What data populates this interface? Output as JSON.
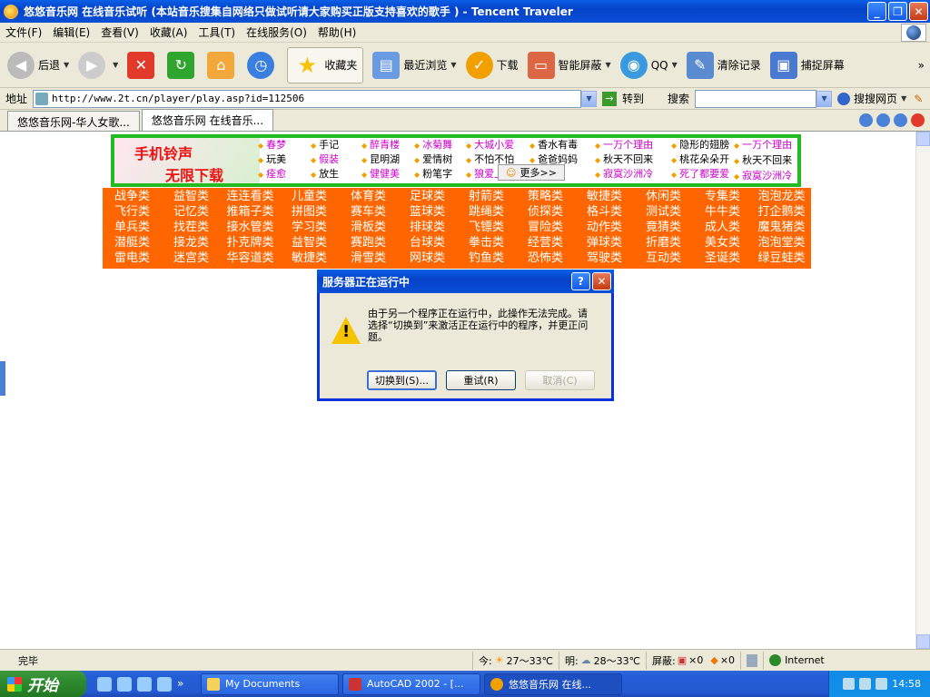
{
  "window": {
    "title": "悠悠音乐网 在线音乐试听 (本站音乐搜集自网络只做试听请大家购买正版支持喜欢的歌手 ) - Tencent Traveler",
    "buttons": {
      "minimize": "_",
      "restore": "❐",
      "close": "✕"
    }
  },
  "menu": [
    "文件(F)",
    "编辑(E)",
    "查看(V)",
    "收藏(A)",
    "工具(T)",
    "在线服务(O)",
    "帮助(H)"
  ],
  "toolbar": {
    "back": "后退",
    "favorites": "收藏夹",
    "recent": "最近浏览",
    "download": "下载",
    "block": "智能屏蔽",
    "qq": "QQ",
    "clear": "清除记录",
    "capture": "捕捉屏幕",
    "more": "»"
  },
  "address": {
    "label": "地址",
    "url": "http://www.2t.cn/player/play.asp?id=112506",
    "go": "转到",
    "search_label": "搜索",
    "search_engine": "搜搜网页"
  },
  "tabs": [
    {
      "label": "悠悠音乐网-华人女歌..."
    },
    {
      "label": "悠悠音乐网 在线音乐..."
    }
  ],
  "banner": {
    "ad_line1": "手机铃声",
    "ad_line2": "无限下载",
    "songs": [
      "春梦",
      "手记",
      "醉青楼",
      "冰菊舞",
      "大城小爱",
      "香水有毒",
      "一万个理由",
      "隐形的翅膀",
      "玩美",
      "假装",
      "昆明湖",
      "爱情树",
      "不怕不怕",
      "爸爸妈妈",
      "秋天不回来",
      "桃花朵朵开",
      "痊愈",
      "放生",
      "健健美",
      "粉笔字",
      "狼爱上羊",
      "",
      "寂寞沙洲冷",
      "死了都要爱"
    ],
    "extra_col": [
      "一万个理由",
      "秋天不回来",
      "寂寞沙洲冷"
    ],
    "more": "更多>>"
  },
  "categories": [
    "战争类",
    "益智类",
    "连连看类",
    "儿童类",
    "体育类",
    "足球类",
    "射箭类",
    "策略类",
    "敏捷类",
    "休闲类",
    "专集类",
    "泡泡龙类",
    "飞行类",
    "记忆类",
    "推箱子类",
    "拼图类",
    "赛车类",
    "篮球类",
    "跳绳类",
    "侦探类",
    "格斗类",
    "测试类",
    "牛牛类",
    "打企鹅类",
    "单兵类",
    "找茬类",
    "接水管类",
    "学习类",
    "滑板类",
    "排球类",
    "飞镖类",
    "冒险类",
    "动作类",
    "竟猜类",
    "成人类",
    "魔鬼猪类",
    "潜艇类",
    "接龙类",
    "扑克牌类",
    "益智类",
    "赛跑类",
    "台球类",
    "拳击类",
    "经营类",
    "弹球类",
    "折磨类",
    "美女类",
    "泡泡堂类",
    "雷电类",
    "迷宫类",
    "华容道类",
    "敏捷类",
    "滑雪类",
    "网球类",
    "钓鱼类",
    "恐怖类",
    "驾驶类",
    "互动类",
    "圣诞类",
    "绿豆蛙类"
  ],
  "dialog": {
    "title": "服务器正在运行中",
    "message": "由于另一个程序正在运行中，此操作无法完成。请选择“切换到”来激活正在运行中的程序，并更正问题。",
    "switch": "切换到(S)...",
    "retry": "重试(R)",
    "cancel": "取消(C)"
  },
  "status": {
    "done": "完毕",
    "today_label": "今:",
    "today_temp": "27～33℃",
    "tomorrow_label": "明:",
    "tomorrow_temp": "28～33℃",
    "block_label": "屏蔽:",
    "block1": "×0",
    "block2": "×0",
    "zone": "Internet"
  },
  "taskbar": {
    "start": "开始",
    "tasks": [
      "My Documents",
      "AutoCAD 2002 - [...",
      "悠悠音乐网 在线..."
    ],
    "clock": "14:58"
  }
}
